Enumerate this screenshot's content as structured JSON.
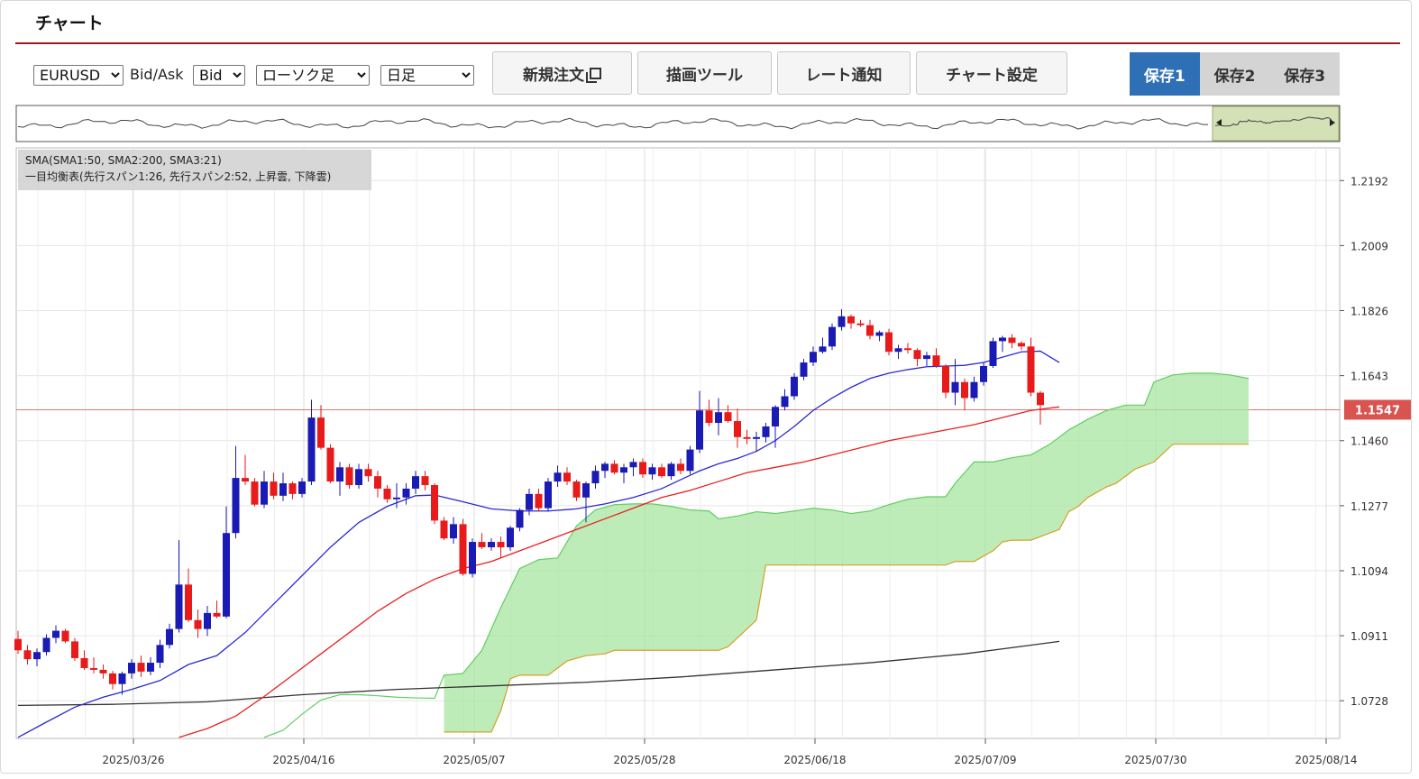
{
  "page": {
    "title": "チャート"
  },
  "toolbar": {
    "symbol": {
      "selected": "EURUSD",
      "options": [
        "EURUSD"
      ]
    },
    "bidask_label": "Bid/Ask",
    "bidask": {
      "selected": "Bid",
      "options": [
        "Bid"
      ]
    },
    "chart_type": {
      "selected": "ローソク足",
      "options": [
        "ローソク足"
      ]
    },
    "period": {
      "selected": "日足",
      "options": [
        "日足"
      ]
    },
    "new_order_label": "新規注文",
    "drawing_tools_label": "描画ツール",
    "rate_alert_label": "レート通知",
    "chart_settings_label": "チャート設定",
    "save_tabs": [
      {
        "label": "保存1",
        "active": true
      },
      {
        "label": "保存2",
        "active": false
      },
      {
        "label": "保存3",
        "active": false
      }
    ]
  },
  "chart_data": {
    "type": "candlestick",
    "instrument": "EURUSD",
    "indicator_legend": [
      "SMA(SMA1:50, SMA2:200, SMA3:21)",
      "一目均衡表(先行スパン1:26, 先行スパン2:52, 上昇雲, 下降雲)"
    ],
    "price_ticks": [
      "1.2192",
      "1.2009",
      "1.1826",
      "1.1643",
      "1.1460",
      "1.1277",
      "1.1094",
      "1.0911",
      "1.0728"
    ],
    "price_range": [
      1.0622,
      1.2284
    ],
    "date_ticks": [
      "2025/03/26",
      "2025/04/16",
      "2025/05/07",
      "2025/05/28",
      "2025/06/18",
      "2025/07/09",
      "2025/07/30",
      "2025/08/14"
    ],
    "current_price": "1.1547",
    "colors": {
      "up": "#1a1ab4",
      "down": "#e81a1a",
      "sma_short": "#2a2ad0",
      "sma_mid": "#e82020",
      "sma_long": "#333333",
      "cloud": "#a8e6a0",
      "span_a": "#5fcf5f",
      "span_b": "#d6a02a",
      "current_price_bg": "#d9534f"
    },
    "candles": [
      [
        1.0902,
        1.0925,
        1.086,
        1.087
      ],
      [
        1.087,
        1.0885,
        1.083,
        1.0845
      ],
      [
        1.0845,
        1.0875,
        1.0825,
        1.0865
      ],
      [
        1.0865,
        1.0915,
        1.0855,
        1.0905
      ],
      [
        1.0905,
        1.094,
        1.089,
        1.0925
      ],
      [
        1.0925,
        1.093,
        1.089,
        1.0895
      ],
      [
        1.0895,
        1.0905,
        1.084,
        1.0848
      ],
      [
        1.0848,
        1.087,
        1.0815,
        1.082
      ],
      [
        1.082,
        1.085,
        1.0805,
        1.0815
      ],
      [
        1.0815,
        1.083,
        1.079,
        1.0805
      ],
      [
        1.0805,
        1.0812,
        1.076,
        1.0775
      ],
      [
        1.0775,
        1.081,
        1.0745,
        1.0805
      ],
      [
        1.0805,
        1.0845,
        1.079,
        1.0835
      ],
      [
        1.0835,
        1.0855,
        1.0795,
        1.081
      ],
      [
        1.081,
        1.085,
        1.08,
        1.0835
      ],
      [
        1.0835,
        1.09,
        1.082,
        1.0885
      ],
      [
        1.0885,
        1.0945,
        1.0875,
        1.093
      ],
      [
        1.093,
        1.118,
        1.092,
        1.1055
      ],
      [
        1.1055,
        1.11,
        1.095,
        1.0955
      ],
      [
        1.0955,
        1.0985,
        1.0905,
        1.093
      ],
      [
        1.093,
        1.0995,
        1.091,
        1.0975
      ],
      [
        1.0975,
        1.101,
        1.096,
        1.0965
      ],
      [
        1.0965,
        1.1275,
        1.096,
        1.12
      ],
      [
        1.12,
        1.1445,
        1.1185,
        1.1355
      ],
      [
        1.1355,
        1.142,
        1.1335,
        1.1345
      ],
      [
        1.1345,
        1.1355,
        1.1275,
        1.128
      ],
      [
        1.128,
        1.1375,
        1.127,
        1.1345
      ],
      [
        1.1345,
        1.137,
        1.1295,
        1.1305
      ],
      [
        1.1305,
        1.137,
        1.129,
        1.134
      ],
      [
        1.134,
        1.1345,
        1.1295,
        1.131
      ],
      [
        1.131,
        1.1355,
        1.13,
        1.1345
      ],
      [
        1.1345,
        1.1575,
        1.1335,
        1.1525
      ],
      [
        1.1525,
        1.156,
        1.1435,
        1.144
      ],
      [
        1.144,
        1.145,
        1.134,
        1.1345
      ],
      [
        1.1345,
        1.14,
        1.1305,
        1.1385
      ],
      [
        1.1385,
        1.1395,
        1.1325,
        1.1335
      ],
      [
        1.1335,
        1.1395,
        1.1325,
        1.138
      ],
      [
        1.138,
        1.1395,
        1.1345,
        1.136
      ],
      [
        1.136,
        1.1375,
        1.13,
        1.1325
      ],
      [
        1.1325,
        1.1335,
        1.1285,
        1.1295
      ],
      [
        1.1295,
        1.134,
        1.127,
        1.13
      ],
      [
        1.13,
        1.134,
        1.128,
        1.1325
      ],
      [
        1.1325,
        1.1375,
        1.131,
        1.136
      ],
      [
        1.136,
        1.1375,
        1.132,
        1.1335
      ],
      [
        1.1335,
        1.134,
        1.1225,
        1.1235
      ],
      [
        1.1235,
        1.1245,
        1.118,
        1.1185
      ],
      [
        1.1185,
        1.1245,
        1.117,
        1.1225
      ],
      [
        1.1225,
        1.124,
        1.108,
        1.1085
      ],
      [
        1.1085,
        1.1185,
        1.1075,
        1.1175
      ],
      [
        1.1175,
        1.12,
        1.1155,
        1.116
      ],
      [
        1.116,
        1.1185,
        1.115,
        1.1175
      ],
      [
        1.1175,
        1.119,
        1.113,
        1.116
      ],
      [
        1.116,
        1.122,
        1.115,
        1.1215
      ],
      [
        1.1215,
        1.127,
        1.1205,
        1.1265
      ],
      [
        1.1265,
        1.1325,
        1.125,
        1.131
      ],
      [
        1.131,
        1.1325,
        1.126,
        1.127
      ],
      [
        1.127,
        1.1355,
        1.126,
        1.1345
      ],
      [
        1.1345,
        1.139,
        1.133,
        1.137
      ],
      [
        1.137,
        1.1385,
        1.1335,
        1.1345
      ],
      [
        1.1345,
        1.135,
        1.129,
        1.13
      ],
      [
        1.13,
        1.1345,
        1.123,
        1.134
      ],
      [
        1.134,
        1.139,
        1.1325,
        1.1375
      ],
      [
        1.1375,
        1.14,
        1.1355,
        1.1395
      ],
      [
        1.1395,
        1.1405,
        1.1365,
        1.137
      ],
      [
        1.137,
        1.1395,
        1.134,
        1.1385
      ],
      [
        1.1385,
        1.141,
        1.136,
        1.14
      ],
      [
        1.14,
        1.141,
        1.1355,
        1.1365
      ],
      [
        1.1365,
        1.1395,
        1.135,
        1.1385
      ],
      [
        1.1385,
        1.1395,
        1.1355,
        1.136
      ],
      [
        1.136,
        1.14,
        1.135,
        1.1395
      ],
      [
        1.1395,
        1.141,
        1.1365,
        1.1375
      ],
      [
        1.1375,
        1.1445,
        1.1365,
        1.1435
      ],
      [
        1.1435,
        1.16,
        1.1425,
        1.1545
      ],
      [
        1.1545,
        1.1575,
        1.15,
        1.151
      ],
      [
        1.151,
        1.158,
        1.1475,
        1.154
      ],
      [
        1.154,
        1.156,
        1.151,
        1.1515
      ],
      [
        1.1515,
        1.155,
        1.144,
        1.147
      ],
      [
        1.147,
        1.149,
        1.145,
        1.1465
      ],
      [
        1.1465,
        1.1485,
        1.143,
        1.147
      ],
      [
        1.147,
        1.151,
        1.1455,
        1.15
      ],
      [
        1.15,
        1.156,
        1.144,
        1.1555
      ],
      [
        1.1555,
        1.1605,
        1.1545,
        1.1585
      ],
      [
        1.1585,
        1.165,
        1.1575,
        1.164
      ],
      [
        1.164,
        1.169,
        1.163,
        1.168
      ],
      [
        1.168,
        1.1725,
        1.167,
        1.171
      ],
      [
        1.171,
        1.175,
        1.1705,
        1.1725
      ],
      [
        1.1725,
        1.179,
        1.1715,
        1.178
      ],
      [
        1.178,
        1.183,
        1.177,
        1.181
      ],
      [
        1.181,
        1.1815,
        1.1775,
        1.179
      ],
      [
        1.179,
        1.18,
        1.178,
        1.1785
      ],
      [
        1.1785,
        1.18,
        1.1745,
        1.1755
      ],
      [
        1.1755,
        1.177,
        1.174,
        1.1765
      ],
      [
        1.1765,
        1.1775,
        1.17,
        1.171
      ],
      [
        1.171,
        1.173,
        1.169,
        1.172
      ],
      [
        1.172,
        1.1735,
        1.1705,
        1.1715
      ],
      [
        1.1715,
        1.172,
        1.167,
        1.169
      ],
      [
        1.169,
        1.171,
        1.167,
        1.17
      ],
      [
        1.17,
        1.172,
        1.1665,
        1.167
      ],
      [
        1.167,
        1.1675,
        1.158,
        1.1595
      ],
      [
        1.1595,
        1.169,
        1.156,
        1.1625
      ],
      [
        1.1625,
        1.1635,
        1.1545,
        1.158
      ],
      [
        1.158,
        1.164,
        1.157,
        1.1625
      ],
      [
        1.1625,
        1.168,
        1.1615,
        1.167
      ],
      [
        1.167,
        1.175,
        1.1665,
        1.174
      ],
      [
        1.174,
        1.1755,
        1.171,
        1.175
      ],
      [
        1.175,
        1.176,
        1.172,
        1.1735
      ],
      [
        1.1735,
        1.174,
        1.1715,
        1.1725
      ],
      [
        1.1725,
        1.175,
        1.1585,
        1.1595
      ],
      [
        1.1595,
        1.16,
        1.1505,
        1.156
      ]
    ],
    "sma_short": [
      [
        0,
        1.0625
      ],
      [
        3,
        1.0668
      ],
      [
        6,
        1.071
      ],
      [
        9,
        1.0738
      ],
      [
        12,
        1.076
      ],
      [
        15,
        1.0785
      ],
      [
        18,
        1.083
      ],
      [
        21,
        1.0855
      ],
      [
        24,
        1.092
      ],
      [
        27,
        1.1
      ],
      [
        30,
        1.108
      ],
      [
        33,
        1.116
      ],
      [
        36,
        1.123
      ],
      [
        39,
        1.1275
      ],
      [
        42,
        1.1305
      ],
      [
        44,
        1.1307
      ],
      [
        47,
        1.1288
      ],
      [
        50,
        1.1268
      ],
      [
        53,
        1.1262
      ],
      [
        56,
        1.1262
      ],
      [
        59,
        1.1268
      ],
      [
        62,
        1.1282
      ],
      [
        65,
        1.13
      ],
      [
        68,
        1.1325
      ],
      [
        70,
        1.135
      ],
      [
        72,
        1.1375
      ],
      [
        74,
        1.1395
      ],
      [
        76,
        1.141
      ],
      [
        78,
        1.143
      ],
      [
        80,
        1.146
      ],
      [
        82,
        1.15
      ],
      [
        84,
        1.1545
      ],
      [
        86,
        1.158
      ],
      [
        88,
        1.161
      ],
      [
        90,
        1.1635
      ],
      [
        92,
        1.165
      ],
      [
        94,
        1.166
      ],
      [
        96,
        1.1668
      ],
      [
        98,
        1.167
      ],
      [
        100,
        1.1672
      ],
      [
        102,
        1.168
      ],
      [
        104,
        1.1695
      ],
      [
        106,
        1.171
      ],
      [
        108,
        1.1712
      ],
      [
        110,
        1.168
      ]
    ],
    "sma_mid": [
      [
        17,
        1.0625
      ],
      [
        20,
        1.065
      ],
      [
        23,
        1.0685
      ],
      [
        26,
        1.074
      ],
      [
        29,
        1.08
      ],
      [
        32,
        1.086
      ],
      [
        35,
        1.092
      ],
      [
        38,
        1.098
      ],
      [
        41,
        1.103
      ],
      [
        44,
        1.107
      ],
      [
        47,
        1.11
      ],
      [
        50,
        1.112
      ],
      [
        53,
        1.115
      ],
      [
        56,
        1.118
      ],
      [
        59,
        1.121
      ],
      [
        62,
        1.124
      ],
      [
        65,
        1.127
      ],
      [
        68,
        1.13
      ],
      [
        71,
        1.132
      ],
      [
        74,
        1.1345
      ],
      [
        77,
        1.137
      ],
      [
        80,
        1.1385
      ],
      [
        83,
        1.14
      ],
      [
        86,
        1.142
      ],
      [
        89,
        1.144
      ],
      [
        92,
        1.146
      ],
      [
        95,
        1.1475
      ],
      [
        98,
        1.149
      ],
      [
        101,
        1.1505
      ],
      [
        104,
        1.1525
      ],
      [
        107,
        1.1545
      ],
      [
        110,
        1.1555
      ]
    ],
    "sma_long": [
      [
        0,
        1.0715
      ],
      [
        10,
        1.0718
      ],
      [
        20,
        1.0725
      ],
      [
        30,
        1.0745
      ],
      [
        40,
        1.076
      ],
      [
        50,
        1.077
      ],
      [
        60,
        1.078
      ],
      [
        70,
        1.0795
      ],
      [
        80,
        1.0815
      ],
      [
        90,
        1.0835
      ],
      [
        100,
        1.086
      ],
      [
        110,
        1.0895
      ]
    ],
    "span_a": [
      [
        26,
        1.0625
      ],
      [
        28,
        1.0645
      ],
      [
        30,
        1.069
      ],
      [
        32,
        1.073
      ],
      [
        34,
        1.0745
      ],
      [
        36,
        1.0745
      ],
      [
        38,
        1.0742
      ],
      [
        40,
        1.0738
      ],
      [
        42,
        1.0736
      ],
      [
        44,
        1.0735
      ],
      [
        45,
        1.08
      ],
      [
        47,
        1.0805
      ],
      [
        49,
        1.087
      ],
      [
        51,
        1.099
      ],
      [
        53,
        1.11
      ],
      [
        55,
        1.1125
      ],
      [
        57,
        1.113
      ],
      [
        59,
        1.122
      ],
      [
        61,
        1.1265
      ],
      [
        63,
        1.128
      ],
      [
        65,
        1.1282
      ],
      [
        67,
        1.1282
      ],
      [
        69,
        1.1275
      ],
      [
        71,
        1.1265
      ],
      [
        73,
        1.1262
      ],
      [
        74,
        1.124
      ],
      [
        76,
        1.1248
      ],
      [
        78,
        1.126
      ],
      [
        80,
        1.1255
      ],
      [
        82,
        1.1262
      ],
      [
        84,
        1.127
      ],
      [
        86,
        1.1265
      ],
      [
        88,
        1.1255
      ],
      [
        90,
        1.1262
      ],
      [
        92,
        1.128
      ],
      [
        94,
        1.1295
      ],
      [
        96,
        1.1302
      ],
      [
        98,
        1.1302
      ],
      [
        99,
        1.134
      ],
      [
        101,
        1.14
      ],
      [
        103,
        1.14
      ],
      [
        105,
        1.1412
      ],
      [
        107,
        1.142
      ],
      [
        109,
        1.145
      ],
      [
        111,
        1.149
      ],
      [
        113,
        1.152
      ],
      [
        115,
        1.1545
      ],
      [
        117,
        1.156
      ],
      [
        119,
        1.156
      ],
      [
        120,
        1.1625
      ],
      [
        122,
        1.1645
      ],
      [
        124,
        1.165
      ],
      [
        126,
        1.165
      ],
      [
        128,
        1.1645
      ],
      [
        130,
        1.1635
      ]
    ],
    "span_b": [
      [
        45,
        1.064
      ],
      [
        50,
        1.064
      ],
      [
        51,
        1.07
      ],
      [
        52,
        1.079
      ],
      [
        53,
        1.08
      ],
      [
        56,
        1.08
      ],
      [
        58,
        1.084
      ],
      [
        60,
        1.0855
      ],
      [
        62,
        1.086
      ],
      [
        63,
        1.087
      ],
      [
        66,
        1.087
      ],
      [
        68,
        1.087
      ],
      [
        72,
        1.087
      ],
      [
        74,
        1.087
      ],
      [
        75,
        1.088
      ],
      [
        78,
        1.0955
      ],
      [
        79,
        1.111
      ],
      [
        82,
        1.111
      ],
      [
        86,
        1.111
      ],
      [
        90,
        1.111
      ],
      [
        95,
        1.111
      ],
      [
        98,
        1.111
      ],
      [
        99,
        1.112
      ],
      [
        101,
        1.112
      ],
      [
        103,
        1.115
      ],
      [
        104,
        1.1175
      ],
      [
        105,
        1.118
      ],
      [
        107,
        1.118
      ],
      [
        109,
        1.12
      ],
      [
        110,
        1.121
      ],
      [
        111,
        1.126
      ],
      [
        112,
        1.1275
      ],
      [
        113,
        1.13
      ],
      [
        115,
        1.133
      ],
      [
        116,
        1.134
      ],
      [
        118,
        1.138
      ],
      [
        120,
        1.14
      ],
      [
        121,
        1.1425
      ],
      [
        122,
        1.145
      ],
      [
        126,
        1.145
      ],
      [
        130,
        1.145
      ]
    ]
  }
}
